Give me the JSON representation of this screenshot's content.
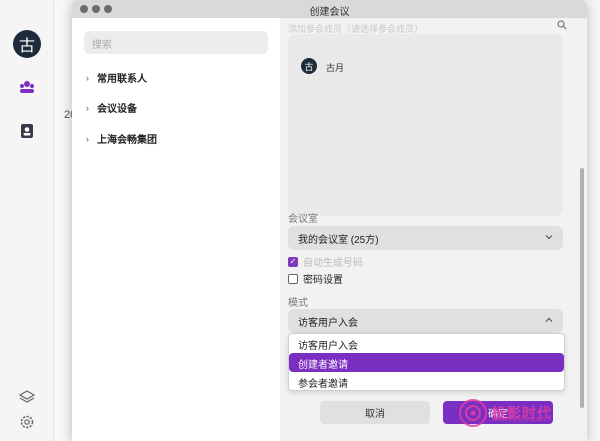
{
  "app": {
    "avatar_char": "古",
    "main_text": "20"
  },
  "dialog": {
    "title": "创建会议"
  },
  "left_pane": {
    "search_placeholder": "搜索",
    "tree": [
      {
        "label": "常用联系人"
      },
      {
        "label": "会议设备"
      },
      {
        "label": "上海会畅集团"
      }
    ]
  },
  "right_pane": {
    "faded_top": "添加参会成员（请选择参会成员）",
    "participant": {
      "avatar_char": "古",
      "name": "古月"
    },
    "room_label": "会议室",
    "room_value": "我的会议室 (25方)",
    "auto_code_label": "自动生成号码",
    "password_label": "密码设置",
    "mode_label": "模式",
    "mode_value": "访客用户入会",
    "mode_options": [
      {
        "label": "访客用户入会",
        "selected": false
      },
      {
        "label": "创建者邀请",
        "selected": true
      },
      {
        "label": "参会者邀请",
        "selected": false
      }
    ],
    "cancel_label": "取消",
    "ok_label": "确定"
  },
  "watermark": {
    "text": "投影时代",
    "sub": "www.PjTime.com"
  },
  "colors": {
    "accent": "#7b2ec2",
    "watermark": "#e23ea0"
  }
}
